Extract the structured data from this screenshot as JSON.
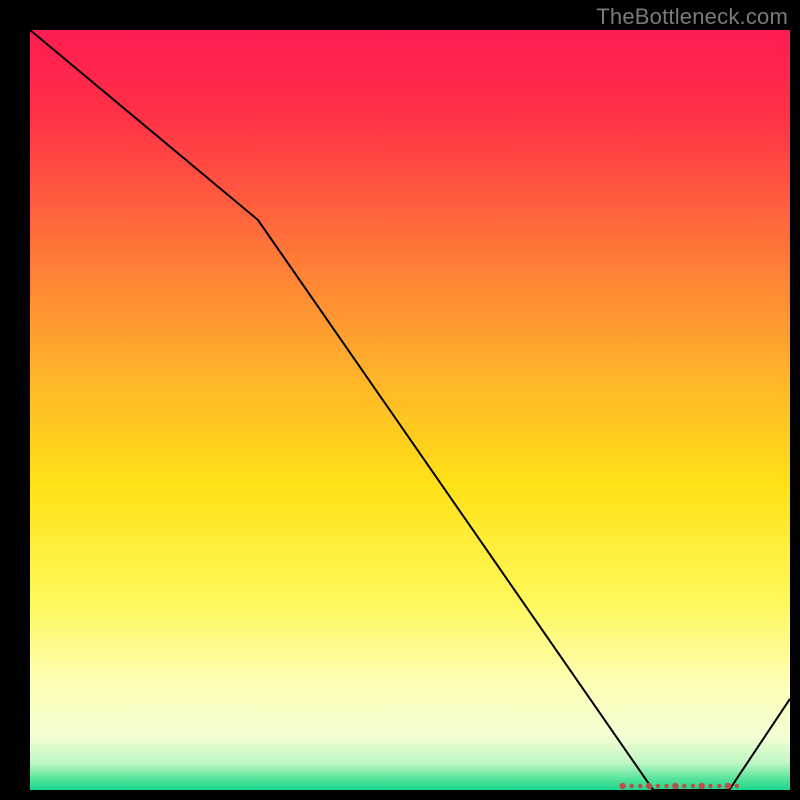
{
  "attribution": "TheBottleneck.com",
  "chart_data": {
    "type": "line",
    "title": "",
    "xlabel": "",
    "ylabel": "",
    "xlim": [
      0,
      100
    ],
    "ylim": [
      0,
      100
    ],
    "grid": false,
    "legend": false,
    "x": [
      0,
      30,
      82,
      92,
      100
    ],
    "values": [
      100,
      75,
      0,
      0,
      12
    ],
    "optimal_band_x": [
      78,
      93
    ],
    "gradient_stops": [
      {
        "offset": 0.0,
        "color": "#ff1b52"
      },
      {
        "offset": 0.12,
        "color": "#ff3346"
      },
      {
        "offset": 0.3,
        "color": "#ff7a38"
      },
      {
        "offset": 0.45,
        "color": "#ffb22a"
      },
      {
        "offset": 0.6,
        "color": "#ffe217"
      },
      {
        "offset": 0.75,
        "color": "#fff85a"
      },
      {
        "offset": 0.86,
        "color": "#ffffb6"
      },
      {
        "offset": 0.93,
        "color": "#f3ffd4"
      },
      {
        "offset": 0.965,
        "color": "#bdf7c3"
      },
      {
        "offset": 0.985,
        "color": "#57e49b"
      },
      {
        "offset": 1.0,
        "color": "#1dd68d"
      }
    ],
    "marker_color": "#c24a4a",
    "line_color": "#000000"
  }
}
